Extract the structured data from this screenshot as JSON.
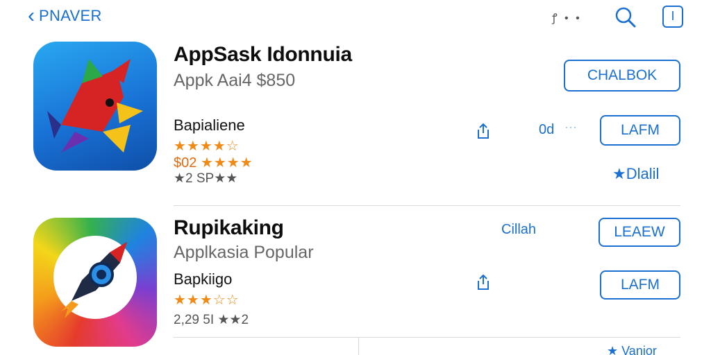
{
  "nav": {
    "back_label": "PNAVER",
    "dots": "ꝭ • •",
    "square_glyph": "I"
  },
  "apps": [
    {
      "title": "AppSask Idonnuia",
      "subtitle": "Appk Aai4 $850",
      "genre": "Bapialiene",
      "stars": "★★★★☆",
      "price": "$02",
      "price_stars": "★★★★",
      "meta": "★2 SP★★",
      "primary_button": "CHALBOK",
      "secondary_button": "LAFM",
      "counter": "0d",
      "rating_link": "★Dlalil"
    },
    {
      "title": "Rupikaking",
      "subtitle": "Applkasia Popular",
      "genre": "Bapkiigo",
      "stars": "★★★☆☆",
      "meta": "2,29 5I ★★2",
      "blue_label": "Cillah",
      "primary_button": "LEAEW",
      "secondary_button": "LAFM"
    }
  ],
  "footer": {
    "text": "★ Vanior"
  },
  "colors": {
    "accent": "#1a6fd1",
    "star": "#f08a17",
    "divider": "#d9d9d9"
  }
}
